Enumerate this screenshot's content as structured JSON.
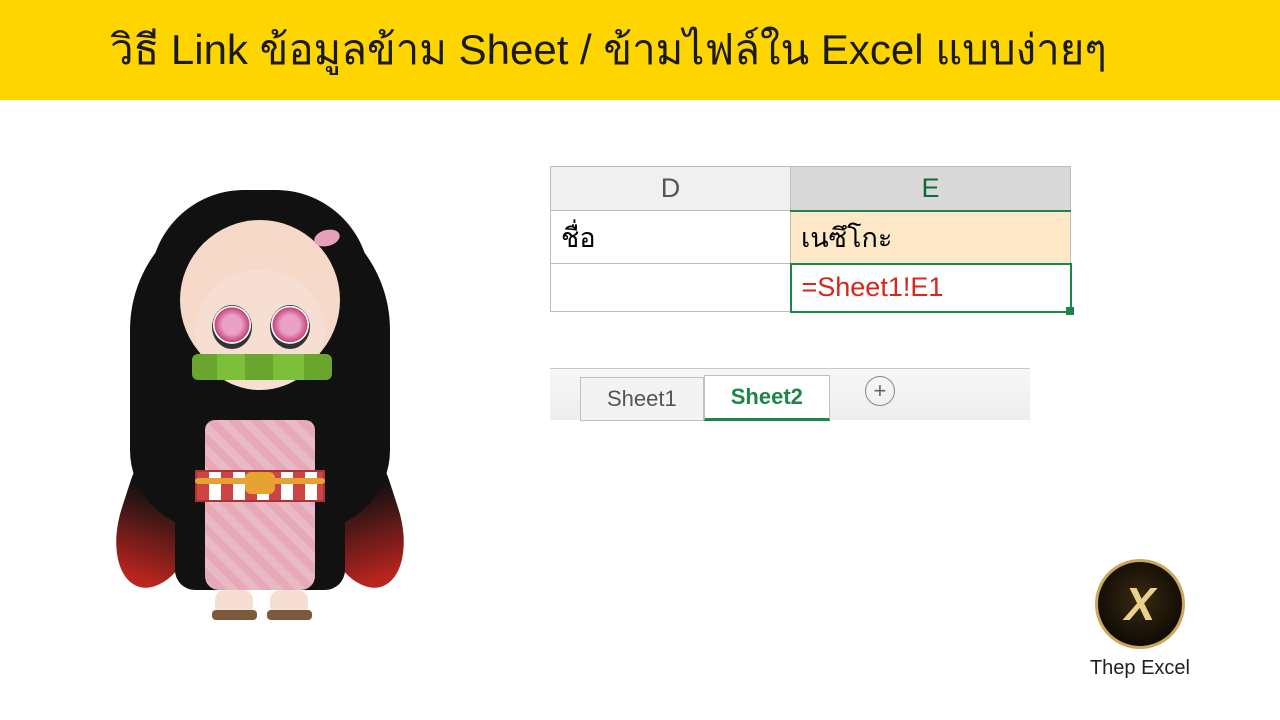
{
  "banner": {
    "title": "วิธี Link ข้อมูลข้าม Sheet / ข้ามไฟล์ใน Excel แบบง่ายๆ"
  },
  "grid": {
    "columns": {
      "d": "D",
      "e": "E"
    },
    "rows": [
      {
        "d": "ชื่อ",
        "e": "เนซึโกะ"
      },
      {
        "d": "",
        "e": "=Sheet1!E1"
      }
    ]
  },
  "tabs": {
    "sheet1": "Sheet1",
    "sheet2": "Sheet2",
    "add_symbol": "+"
  },
  "brand": {
    "mark": "X",
    "name": "Thep Excel"
  },
  "icons": {
    "character": "nezuko-chibi-figure"
  }
}
